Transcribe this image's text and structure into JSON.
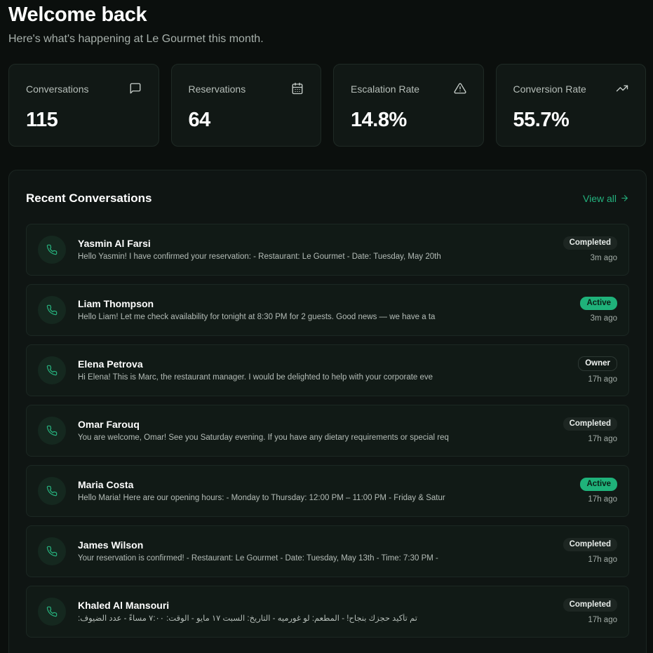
{
  "header": {
    "title": "Welcome back",
    "subtitle": "Here's what's happening at Le Gourmet this month."
  },
  "stats": [
    {
      "label": "Conversations",
      "value": "115",
      "icon": "message-square-icon"
    },
    {
      "label": "Reservations",
      "value": "64",
      "icon": "calendar-icon"
    },
    {
      "label": "Escalation Rate",
      "value": "14.8%",
      "icon": "alert-triangle-icon"
    },
    {
      "label": "Conversion Rate",
      "value": "55.7%",
      "icon": "trending-up-icon"
    }
  ],
  "recent": {
    "title": "Recent Conversations",
    "view_all": "View all",
    "items": [
      {
        "name": "Yasmin Al Farsi",
        "message": "Hello Yasmin! I have confirmed your reservation: - Restaurant: Le Gourmet - Date: Tuesday, May 20th",
        "status": "Completed",
        "time": "3m ago"
      },
      {
        "name": "Liam Thompson",
        "message": "Hello Liam! Let me check availability for tonight at 8:30 PM for 2 guests. Good news — we have a ta",
        "status": "Active",
        "time": "3m ago"
      },
      {
        "name": "Elena Petrova",
        "message": "Hi Elena! This is Marc, the restaurant manager. I would be delighted to help with your corporate eve",
        "status": "Owner",
        "time": "17h ago"
      },
      {
        "name": "Omar Farouq",
        "message": "You are welcome, Omar! See you Saturday evening. If you have any dietary requirements or special req",
        "status": "Completed",
        "time": "17h ago"
      },
      {
        "name": "Maria Costa",
        "message": "Hello Maria! Here are our opening hours: - Monday to Thursday: 12:00 PM – 11:00 PM - Friday & Satur",
        "status": "Active",
        "time": "17h ago"
      },
      {
        "name": "James Wilson",
        "message": "Your reservation is confirmed! - Restaurant: Le Gourmet - Date: Tuesday, May 13th - Time: 7:30 PM -",
        "status": "Completed",
        "time": "17h ago"
      },
      {
        "name": "Khaled Al Mansouri",
        "message": "تم تأكيد حجزك بنجاح! - المطعم: لو غورميه - التاريخ: السبت ١٧ مايو - الوقت: ٧:٠٠ مساءً - عدد الضيوف:",
        "status": "Completed",
        "time": "17h ago"
      }
    ]
  },
  "colors": {
    "accent": "#23b27e",
    "background": "#0b0f0d",
    "card": "#111815"
  }
}
